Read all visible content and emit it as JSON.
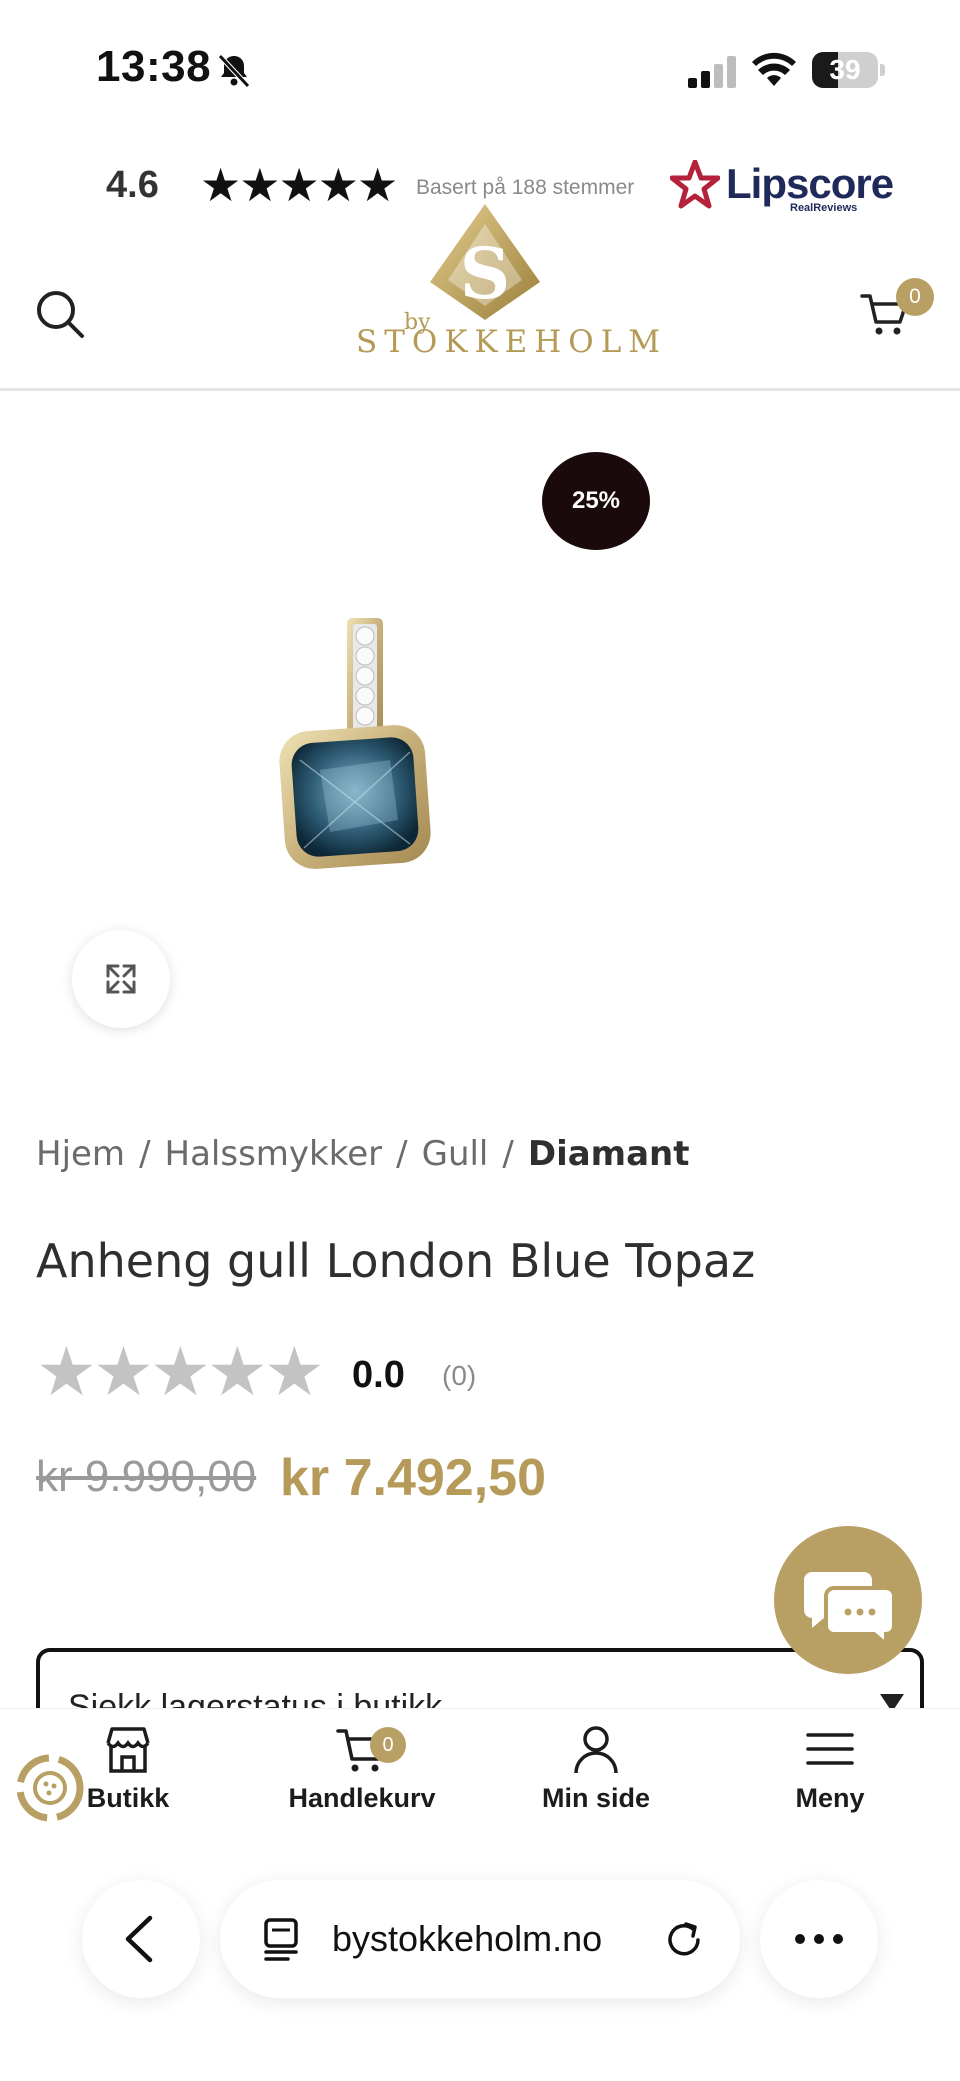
{
  "status_bar": {
    "time": "13:38",
    "battery": "39",
    "battery_level": 0.39
  },
  "review_strip": {
    "score": "4.6",
    "stars": "★★★★★",
    "votes_text": "Basert på 188 stemmer",
    "brand": "Lipscore",
    "brand_sub": "RealReviews"
  },
  "header": {
    "logo_by": "by",
    "logo_text": "STOKKEHOLM",
    "cart_count": "0"
  },
  "product": {
    "discount": "25%",
    "breadcrumb": [
      "Hjem",
      "Halssmykker",
      "Gull",
      "Diamant"
    ],
    "breadcrumb_sep": "/",
    "title": "Anheng gull London Blue Topaz",
    "rating_stars": "★★★★★",
    "rating": "0.0",
    "rating_count": "(0)",
    "old_price": "kr 9.990,00",
    "new_price": "kr 7.492,50",
    "stock_label": "Sjekk lagerstatus i butikk"
  },
  "bottom_nav": {
    "items": [
      {
        "label": "Butikk",
        "icon": "store-icon"
      },
      {
        "label": "Handlekurv",
        "icon": "cart-icon",
        "badge": "0"
      },
      {
        "label": "Min side",
        "icon": "user-icon"
      },
      {
        "label": "Meny",
        "icon": "menu-icon"
      }
    ]
  },
  "browser": {
    "url": "bystokkeholm.no"
  },
  "colors": {
    "gold": "#b8a064",
    "price_gold": "#b69a5a",
    "badge_dark": "#1a0a0c",
    "lipscore_red": "#b3223a"
  }
}
